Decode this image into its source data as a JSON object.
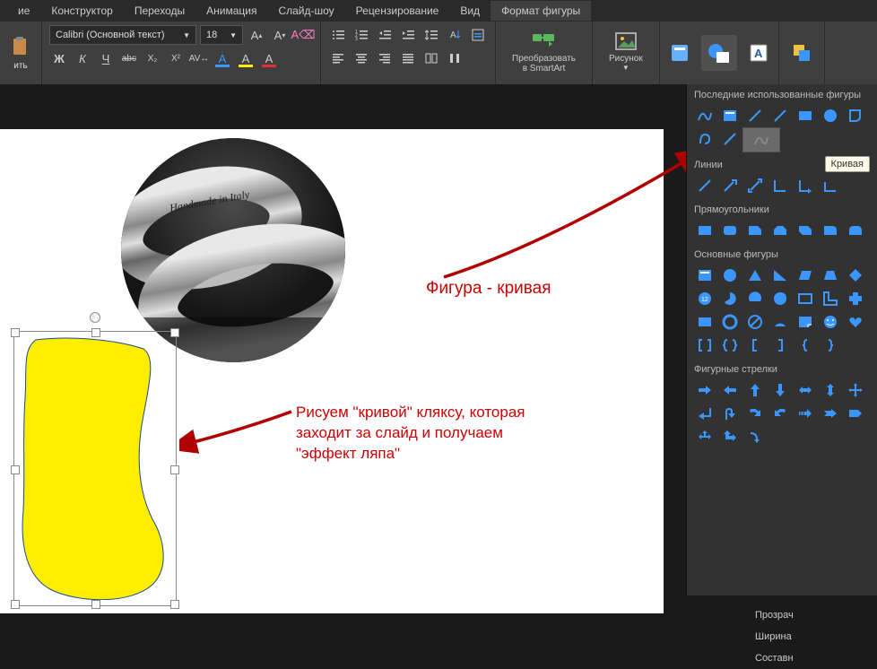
{
  "tabs": {
    "t0": "ие",
    "t1": "Конструктор",
    "t2": "Переходы",
    "t3": "Анимация",
    "t4": "Слайд-шоу",
    "t5": "Рецензирование",
    "t6": "Вид",
    "t7": "Формат фигуры"
  },
  "ribbon": {
    "paste_label": "ить",
    "font_name": "Calibri (Основной текст)",
    "font_size": "18",
    "bold": "Ж",
    "italic": "К",
    "underline": "Ч",
    "strike": "abє",
    "smartart_l1": "Преобразовать",
    "smartart_l2": "в SmartArt",
    "picture": "Рисунок"
  },
  "shapes": {
    "header": "Последние использованные фигуры",
    "section_lines": "Линии",
    "section_rects": "Прямоугольники",
    "section_basic": "Основные фигуры",
    "section_arrows": "Фигурные стрелки",
    "tooltip": "Кривая",
    "badge12": "12"
  },
  "annotations": {
    "a1": "Фигура - кривая",
    "a2_l1": "Рисуем \"кривой\" кляксу, которая",
    "a2_l2": "заходит за слайд и получаем",
    "a2_l3": "\"эффект ляпа\""
  },
  "props": {
    "p1": "Прозрач",
    "p2": "Ширина",
    "p3": "Составн"
  },
  "ring_text": "Handmade in Italy"
}
